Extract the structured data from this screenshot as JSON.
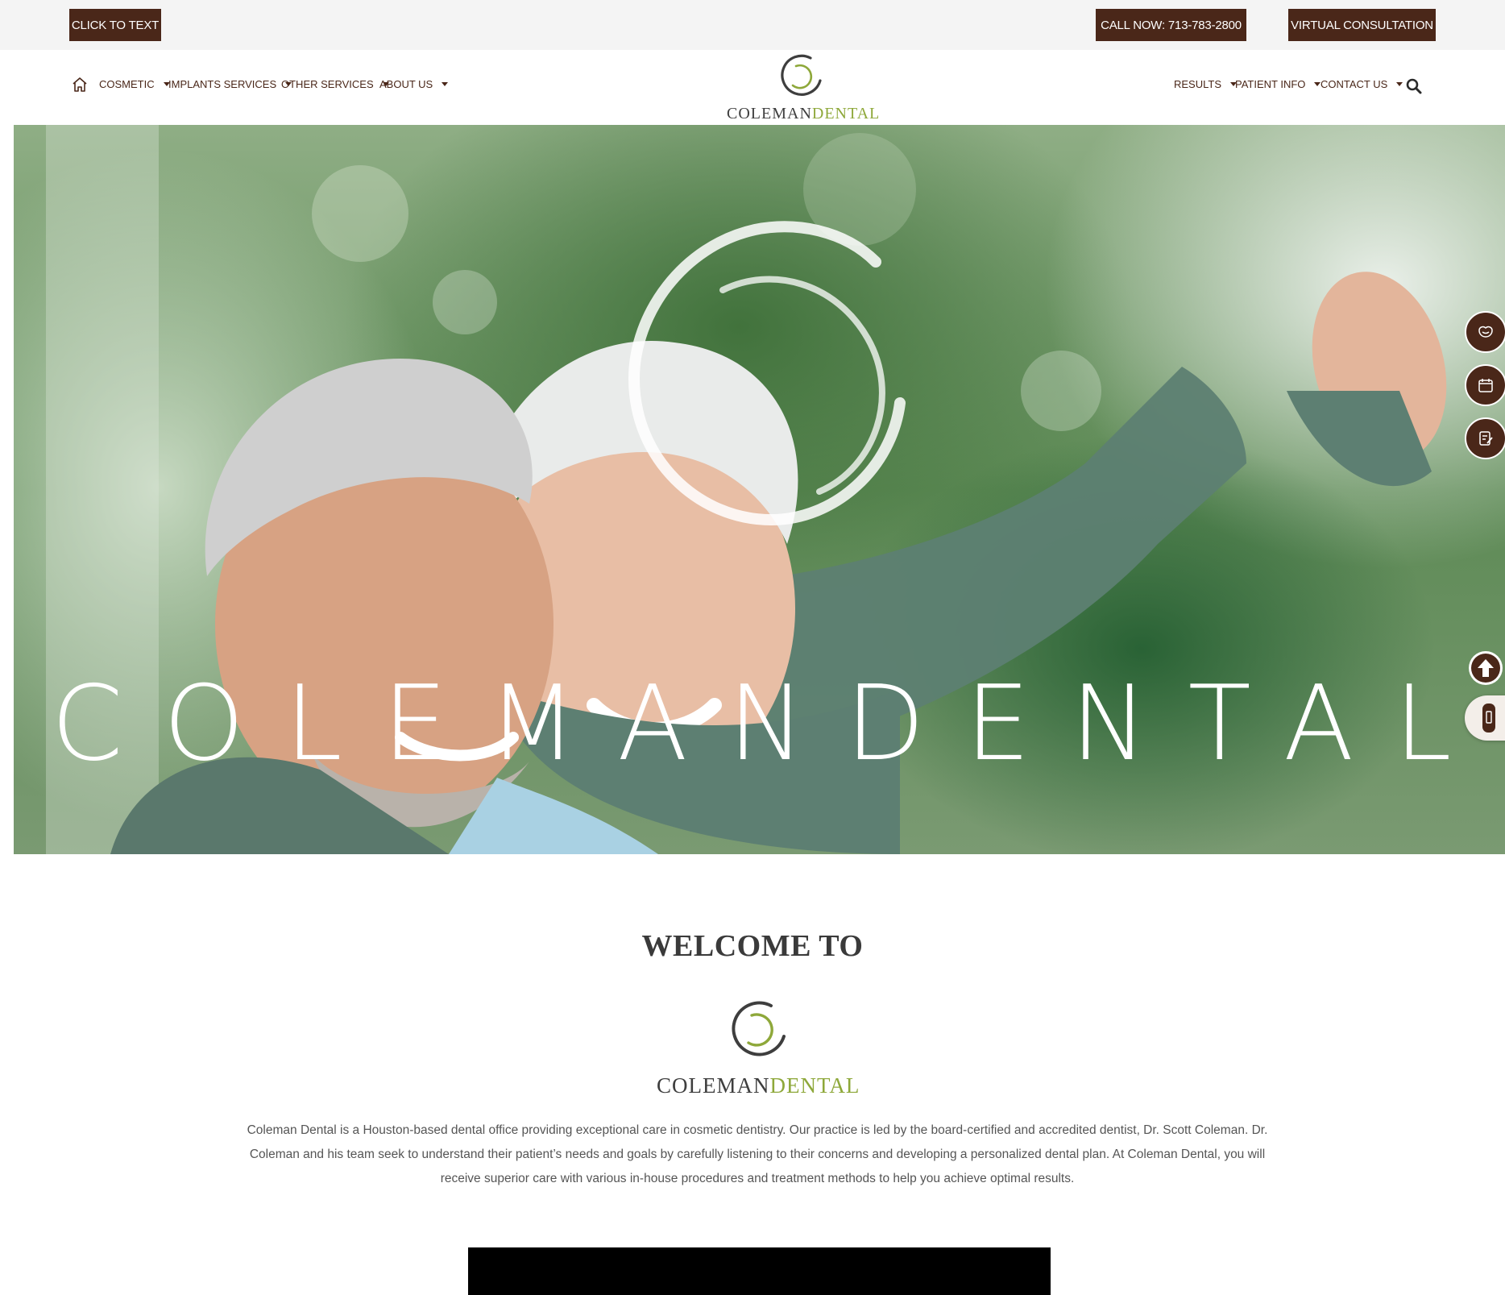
{
  "topbar": {
    "click_to_text": "CLICK TO TEXT",
    "call_now": "CALL NOW: 713-783-2800",
    "virtual_consultation": "VIRTUAL CONSULTATION"
  },
  "nav": {
    "left": [
      {
        "label": "COSMETIC"
      },
      {
        "label": "IMPLANTS SERVICES"
      },
      {
        "label": "OTHER SERVICES"
      },
      {
        "label": "ABOUT US"
      }
    ],
    "right": [
      {
        "label": "RESULTS"
      },
      {
        "label": "PATIENT INFO"
      },
      {
        "label": "CONTACT US"
      }
    ]
  },
  "logo": {
    "word1": "COLEMAN",
    "word2": "DENTAL"
  },
  "hero": {
    "title": "COLEMANDENTAL"
  },
  "side_buttons": [
    "tooth-icon",
    "calendar-icon",
    "form-icon"
  ],
  "welcome": {
    "heading": "WELCOME TO",
    "intro": "Coleman Dental is a Houston-based dental office providing exceptional care in cosmetic dentistry. Our practice is led by the board-certified and accredited dentist, Dr. Scott Coleman. Dr. Coleman and his team seek to understand their patient’s needs and goals by carefully listening to their concerns and developing a personalized dental plan. At Coleman Dental, you will receive superior care with various in-house procedures and treatment methods to help you achieve optimal results."
  },
  "colors": {
    "brand_brown": "#4a2719",
    "brand_green": "#8ea83a",
    "logo_gray": "#3e3e3e"
  }
}
